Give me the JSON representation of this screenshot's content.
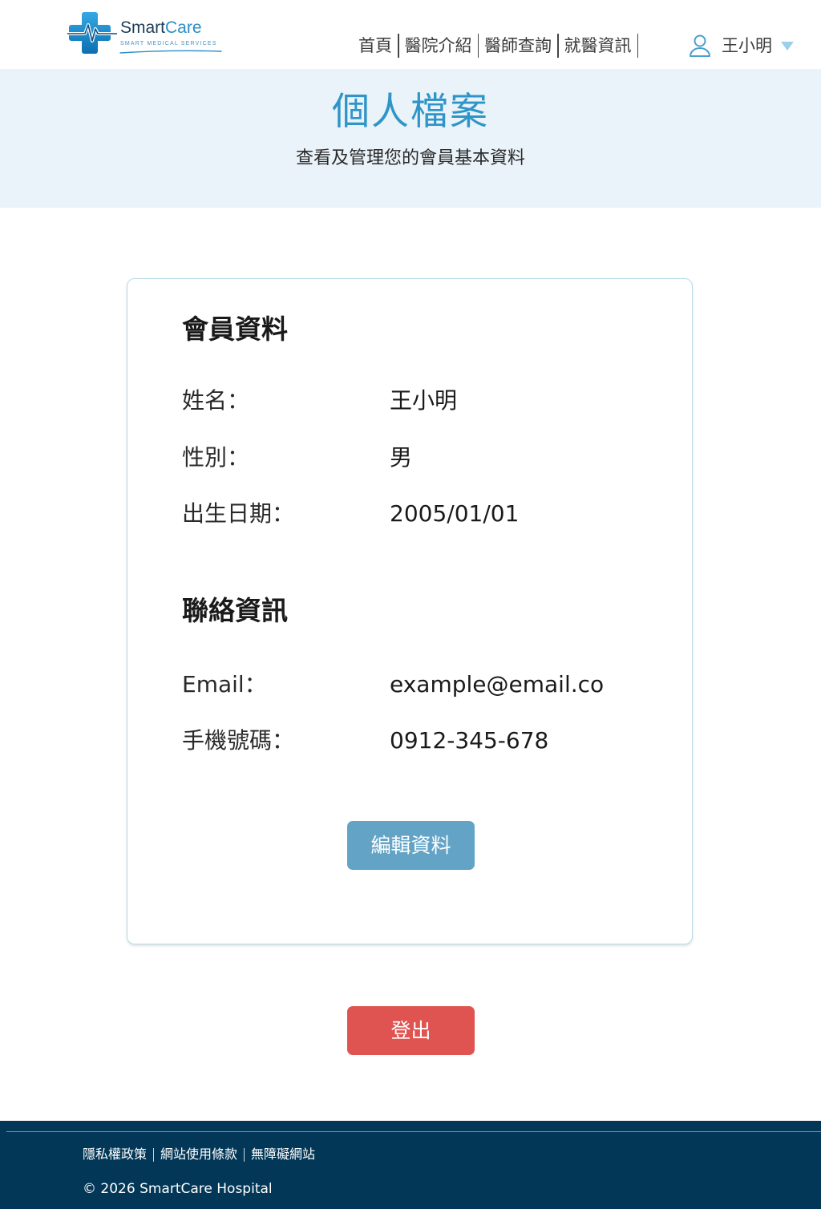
{
  "brand": {
    "name_dark": "Smart",
    "name_accent": "Care",
    "tagline": "SMART MEDICAL SERVICES",
    "logo_icon": "medical-cross-heartbeat-icon",
    "colors": {
      "dark_blue": "#1c3d5a",
      "light_blue": "#2a8fc7"
    }
  },
  "nav": {
    "items": [
      {
        "label": "首頁"
      },
      {
        "label": "醫院介紹"
      },
      {
        "label": "醫師查詢"
      },
      {
        "label": "就醫資訊"
      }
    ],
    "user": {
      "name": "王小明",
      "icon": "user-icon",
      "caret_icon": "caret-down-icon"
    }
  },
  "hero": {
    "title": "個人檔案",
    "subtitle": "查看及管理您的會員基本資料"
  },
  "member_section": {
    "title": "會員資料",
    "fields": [
      {
        "label": "姓名：",
        "value": "王小明"
      },
      {
        "label": "性別：",
        "value": "男"
      },
      {
        "label": "出生日期：",
        "value": "2005/01/01"
      }
    ]
  },
  "contact_section": {
    "title": "聯絡資訊",
    "fields": [
      {
        "label": "Email：",
        "value": "example@email.co"
      },
      {
        "label": "手機號碼：",
        "value": "0912-345-678"
      }
    ]
  },
  "actions": {
    "edit_label": "編輯資料",
    "logout_label": "登出"
  },
  "footer": {
    "links": [
      {
        "label": "隱私權政策"
      },
      {
        "label": "網站使用條款"
      },
      {
        "label": "無障礙網站"
      }
    ],
    "copyright": "© 2026 SmartCare Hospital"
  },
  "colors": {
    "primary": "#2f95c9",
    "hero_bg": "#e9f3f9",
    "card_border": "#b8dce8",
    "edit_button": "#63a4c6",
    "logout_button": "#df5450",
    "footer_bg": "#023757"
  }
}
